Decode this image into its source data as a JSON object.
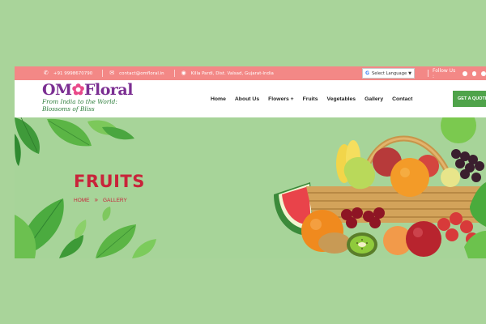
{
  "topbar": {
    "phone": "+91 9998670790",
    "email": "contact@omfloral.in",
    "address": "Killa Pardi, Dist. Valsad, Gujarat-India",
    "language_label": "Select Language",
    "follow_label": "Follow Us :"
  },
  "header": {
    "logo_title_1": "OM",
    "logo_title_2": "Floral",
    "tagline_1": "From India to the World:",
    "tagline_2": "Blossoms of Bliss",
    "nav": [
      "Home",
      "About Us",
      "Flowers +",
      "Fruits",
      "Vegetables",
      "Gallery",
      "Contact"
    ],
    "cta": "GET A QUOTE"
  },
  "hero": {
    "title": "FRUITS",
    "breadcrumb_home": "HOME",
    "breadcrumb_sep": "»",
    "breadcrumb_current": "GALLERY"
  },
  "colors": {
    "topbar": "#f38886",
    "accent_red": "#c8243a",
    "cta_green": "#4fa34a",
    "hero_bg": "#a7d499"
  },
  "icons": {
    "phone": "phone-icon",
    "email": "email-icon",
    "location": "location-pin-icon",
    "social": [
      "facebook-icon",
      "instagram-icon",
      "youtube-icon"
    ]
  }
}
